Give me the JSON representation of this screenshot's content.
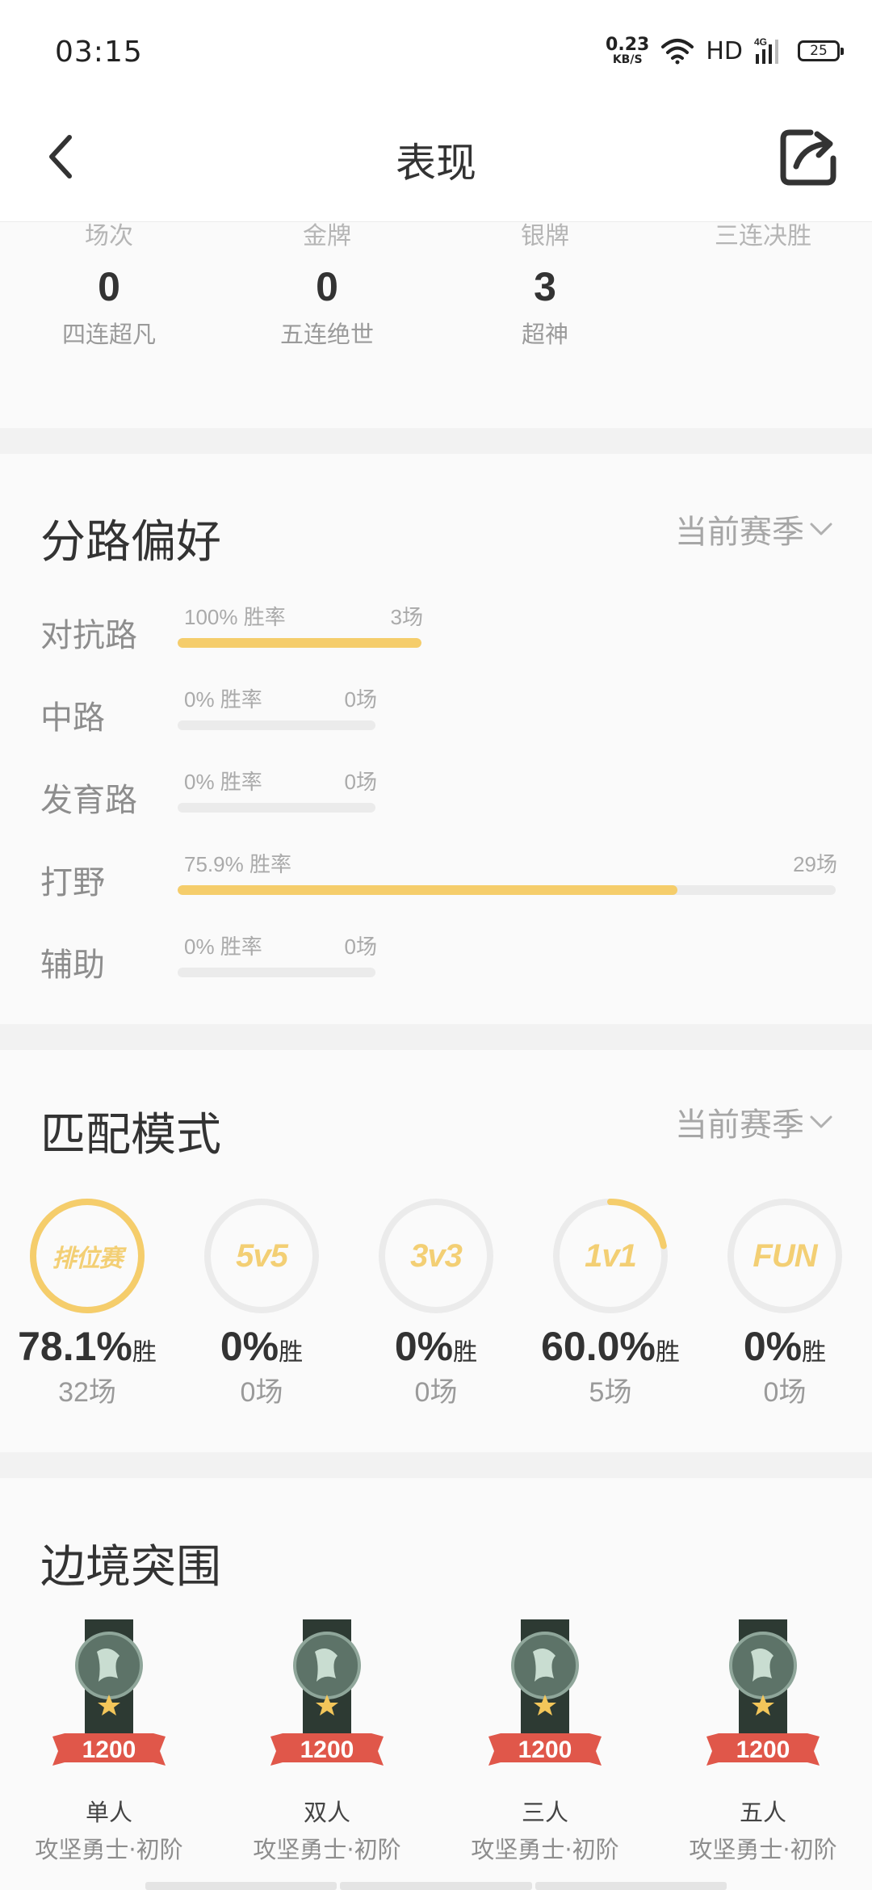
{
  "status_bar": {
    "time": "03:15",
    "net_speed_value": "0.23",
    "net_speed_unit": "KB/S",
    "hd": "HD",
    "network": "4G",
    "battery": "25"
  },
  "header": {
    "title": "表现",
    "back_icon": "chevron-left-icon",
    "share_icon": "share-icon"
  },
  "multikill": {
    "cut_labels": [
      "场次",
      "金牌",
      "银牌",
      "三连决胜"
    ],
    "stats": [
      {
        "value": "0",
        "label": "四连超凡"
      },
      {
        "value": "0",
        "label": "五连绝世"
      },
      {
        "value": "3",
        "label": "超神"
      }
    ]
  },
  "lanes": {
    "title": "分路偏好",
    "season": "当前赛季",
    "items": [
      {
        "name": "对抗路",
        "rate_text": "100% 胜率",
        "count_text": "3场",
        "share": 0.37,
        "win_fraction": 1.0
      },
      {
        "name": "中路",
        "rate_text": "0% 胜率",
        "count_text": "0场",
        "share": 0.3,
        "win_fraction": 0.0
      },
      {
        "name": "发育路",
        "rate_text": "0% 胜率",
        "count_text": "0场",
        "share": 0.3,
        "win_fraction": 0.0
      },
      {
        "name": "打野",
        "rate_text": "75.9% 胜率",
        "count_text": "29场",
        "share": 1.0,
        "win_fraction": 0.759
      },
      {
        "name": "辅助",
        "rate_text": "0% 胜率",
        "count_text": "0场",
        "share": 0.3,
        "win_fraction": 0.0
      }
    ]
  },
  "modes": {
    "title": "匹配模式",
    "season": "当前赛季",
    "win_suffix": "胜",
    "items": [
      {
        "logo": "排位赛",
        "rate": "78.1%",
        "games": "32场",
        "win_fraction": 1.0
      },
      {
        "logo": "5v5",
        "rate": "0%",
        "games": "0场",
        "win_fraction": 0.0
      },
      {
        "logo": "3v3",
        "rate": "0%",
        "games": "0场",
        "win_fraction": 0.0
      },
      {
        "logo": "1v1",
        "rate": "60.0%",
        "games": "5场",
        "win_fraction": 0.22
      },
      {
        "logo": "FUN",
        "rate": "0%",
        "games": "0场",
        "win_fraction": 0.0
      }
    ]
  },
  "border_breakout": {
    "title": "边境突围",
    "items": [
      {
        "score": "1200",
        "mode": "单人",
        "rank": "攻坚勇士·初阶"
      },
      {
        "score": "1200",
        "mode": "双人",
        "rank": "攻坚勇士·初阶"
      },
      {
        "score": "1200",
        "mode": "三人",
        "rank": "攻坚勇士·初阶"
      },
      {
        "score": "1200",
        "mode": "五人",
        "rank": "攻坚勇士·初阶"
      }
    ]
  },
  "colors": {
    "accent": "#f5cd6b",
    "track": "#ebebeb",
    "badge_ribbon": "#e0574a",
    "badge_dark": "#2d3a33"
  }
}
